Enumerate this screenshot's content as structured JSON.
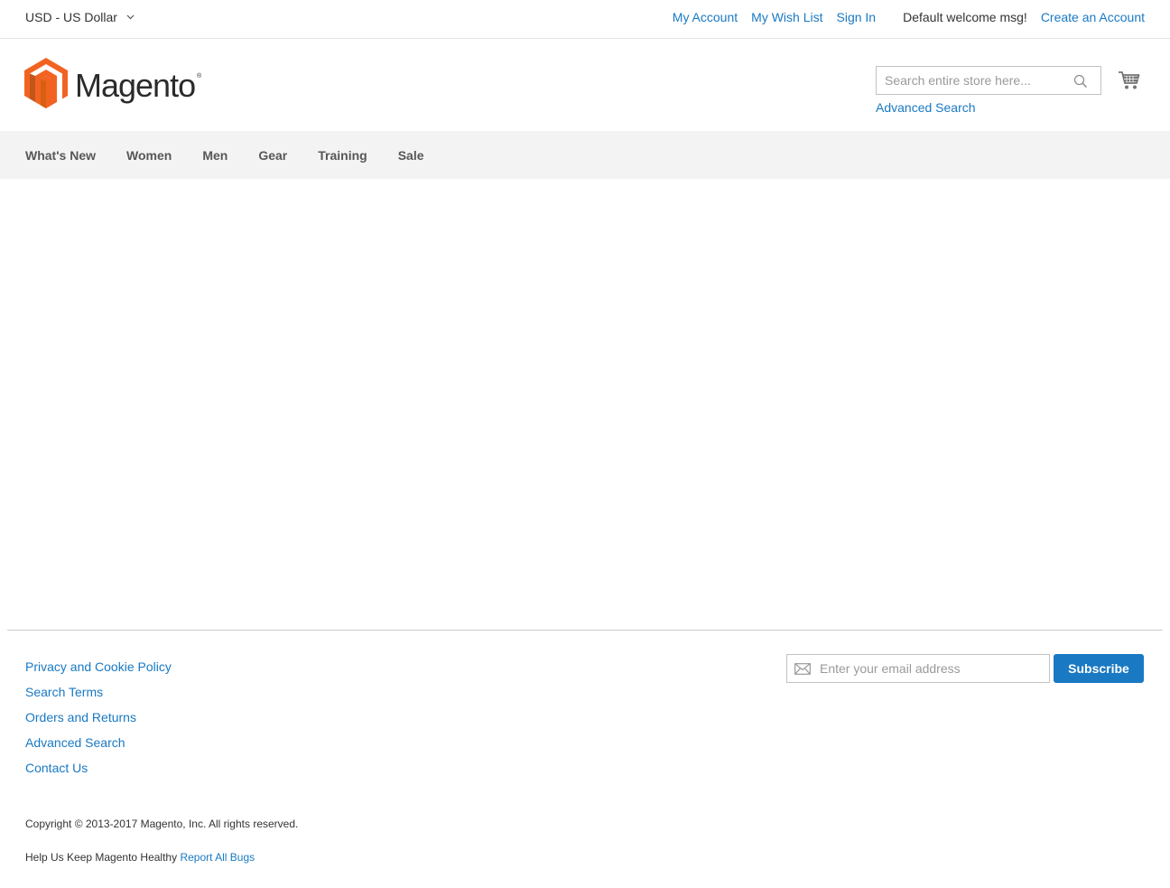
{
  "top_bar": {
    "currency": "USD - US Dollar",
    "links": {
      "my_account": "My Account",
      "my_wish_list": "My Wish List",
      "sign_in": "Sign In",
      "welcome": "Default welcome msg!",
      "create_account": "Create an Account"
    }
  },
  "header": {
    "logo_text": "Magento",
    "logo_reg": "®",
    "search_placeholder": "Search entire store here...",
    "advanced_search": "Advanced Search",
    "icons": {
      "search": "search-icon",
      "cart": "cart-icon",
      "logo": "magento-logo-icon"
    }
  },
  "nav": {
    "items": [
      "What's New",
      "Women",
      "Men",
      "Gear",
      "Training",
      "Sale"
    ]
  },
  "footer": {
    "links": [
      "Privacy and Cookie Policy",
      "Search Terms",
      "Orders and Returns",
      "Advanced Search",
      "Contact Us"
    ],
    "newsletter_placeholder": "Enter your email address",
    "subscribe_label": "Subscribe",
    "copyright": "Copyright © 2013-2017 Magento, Inc. All rights reserved.",
    "help_text": "Help Us Keep Magento Healthy",
    "report_bugs": "Report All Bugs"
  },
  "colors": {
    "link": "#1979c3",
    "logo_orange": "#f26322",
    "nav_bg": "#f3f3f3",
    "button_bg": "#1979c3"
  }
}
